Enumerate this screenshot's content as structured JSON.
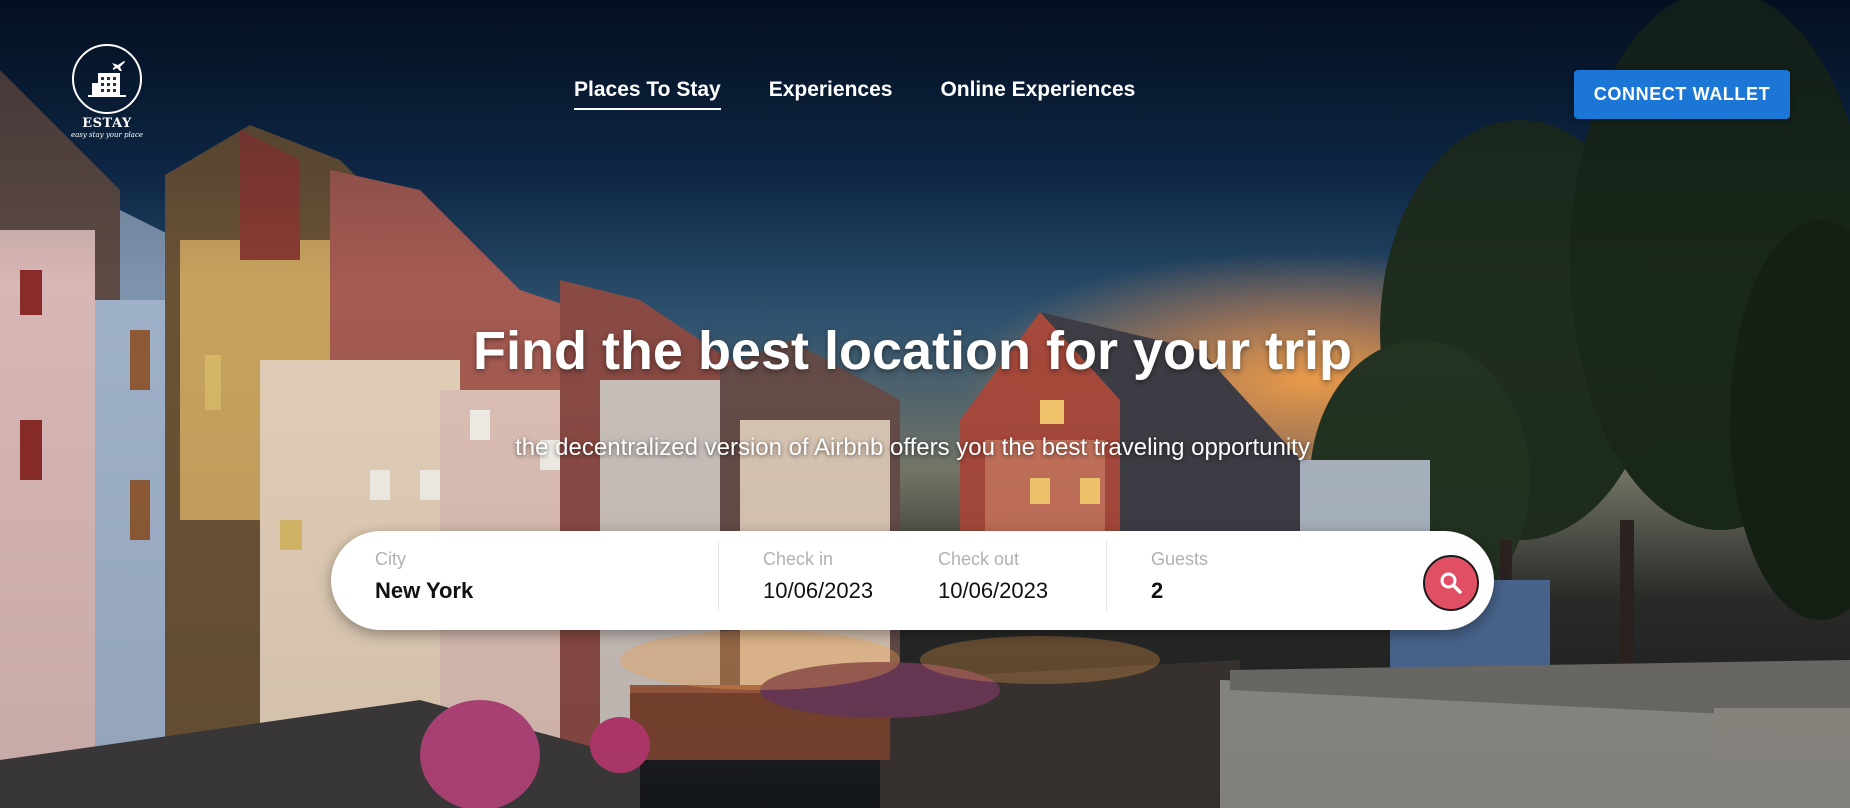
{
  "brand": {
    "name": "ESTAY",
    "tagline": "easy stay your place"
  },
  "nav": {
    "items": [
      {
        "label": "Places To Stay",
        "active": true
      },
      {
        "label": "Experiences",
        "active": false
      },
      {
        "label": "Online Experiences",
        "active": false
      }
    ]
  },
  "header": {
    "wallet_button": "CONNECT WALLET"
  },
  "hero": {
    "title": "Find the best location for your trip",
    "subtitle": "the decentralized version of Airbnb offers you the best traveling opportunity"
  },
  "search": {
    "city": {
      "label": "City",
      "value": "New York"
    },
    "check_in": {
      "label": "Check in",
      "value": "10/06/2023"
    },
    "check_out": {
      "label": "Check out",
      "value": "10/06/2023"
    },
    "guests": {
      "label": "Guests",
      "value": "2"
    },
    "button_icon": "search-icon"
  },
  "colors": {
    "accent_blue": "#1c76d6",
    "search_red": "#e04f63"
  }
}
